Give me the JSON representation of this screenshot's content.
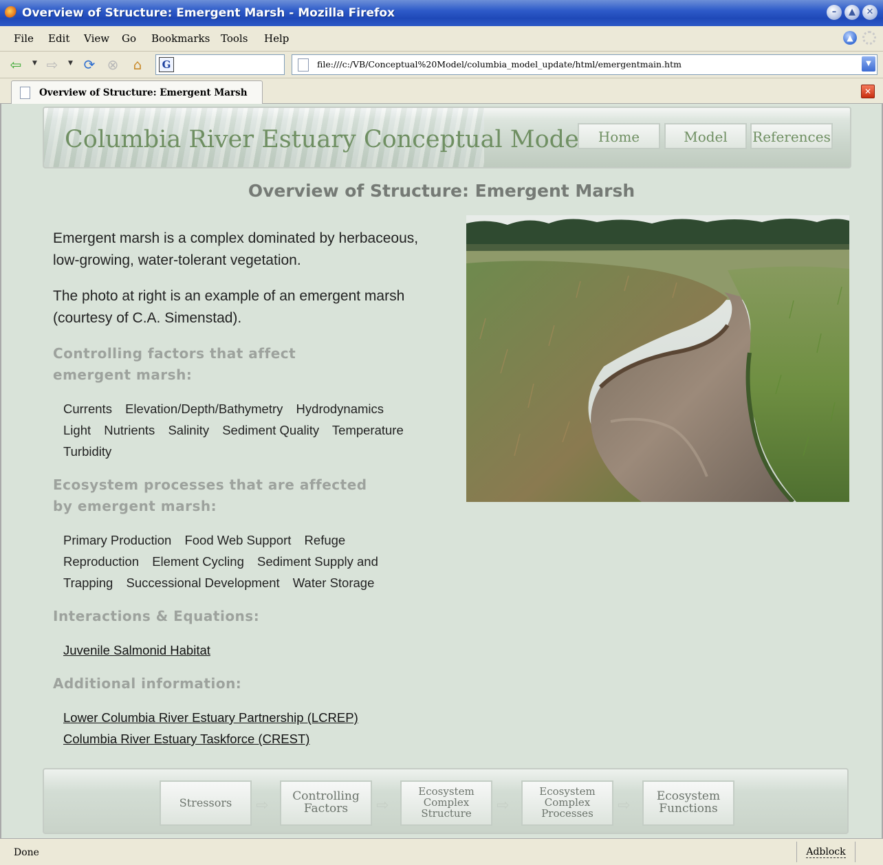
{
  "window": {
    "title": "Overview of Structure: Emergent Marsh - Mozilla Firefox"
  },
  "menu": [
    "File",
    "Edit",
    "View",
    "Go",
    "Bookmarks",
    "Tools",
    "Help"
  ],
  "toolbar": {
    "search_value": "",
    "url": "file:///c:/VB/Conceptual%20Model/columbia_model_update/html/emergentmain.htm"
  },
  "tab": {
    "label": "Overview of Structure: Emergent Marsh"
  },
  "banner": {
    "site_title": "Columbia River Estuary Conceptual Model",
    "nav": [
      "Home",
      "Model",
      "References"
    ]
  },
  "page": {
    "title": "Overview of Structure: Emergent Marsh",
    "intro1": "Emergent marsh is a complex dominated by herbaceous, low-growing, water-tolerant vegetation.",
    "intro2": "The photo at right is an example of an emergent marsh (courtesy of C.A. Simenstad).",
    "controlling_heading": "Controlling factors that affect emergent marsh:",
    "controlling_factors": [
      "Currents",
      "Elevation/Depth/Bathymetry",
      "Hydrodynamics",
      "Light",
      "Nutrients",
      "Salinity",
      "Sediment Quality",
      "Temperature",
      "Turbidity"
    ],
    "processes_heading": "Ecosystem processes that are affected by emergent marsh:",
    "processes": [
      "Primary Production",
      "Food Web Support",
      "Refuge",
      "Reproduction",
      "Element Cycling",
      "Sediment Supply and Trapping",
      "Successional Development",
      "Water Storage"
    ],
    "interactions_heading": "Interactions & Equations:",
    "interaction_links": [
      "Juvenile Salmonid Habitat"
    ],
    "additional_heading": "Additional information:",
    "additional_links": [
      "Lower Columbia River Estuary Partnership (LCREP)",
      "Columbia River Estuary Taskforce (CREST)"
    ]
  },
  "footer_nav": [
    {
      "line1": "Stressors",
      "line2": "",
      "line3": ""
    },
    {
      "line1": "Controlling",
      "line2": "Factors",
      "line3": ""
    },
    {
      "line1": "Ecosystem",
      "line2": "Complex",
      "line3": "Structure"
    },
    {
      "line1": "Ecosystem",
      "line2": "Complex",
      "line3": "Processes"
    },
    {
      "line1": "Ecosystem",
      "line2": "Functions",
      "line3": ""
    }
  ],
  "status": {
    "text": "Done",
    "addon": "Adblock"
  }
}
